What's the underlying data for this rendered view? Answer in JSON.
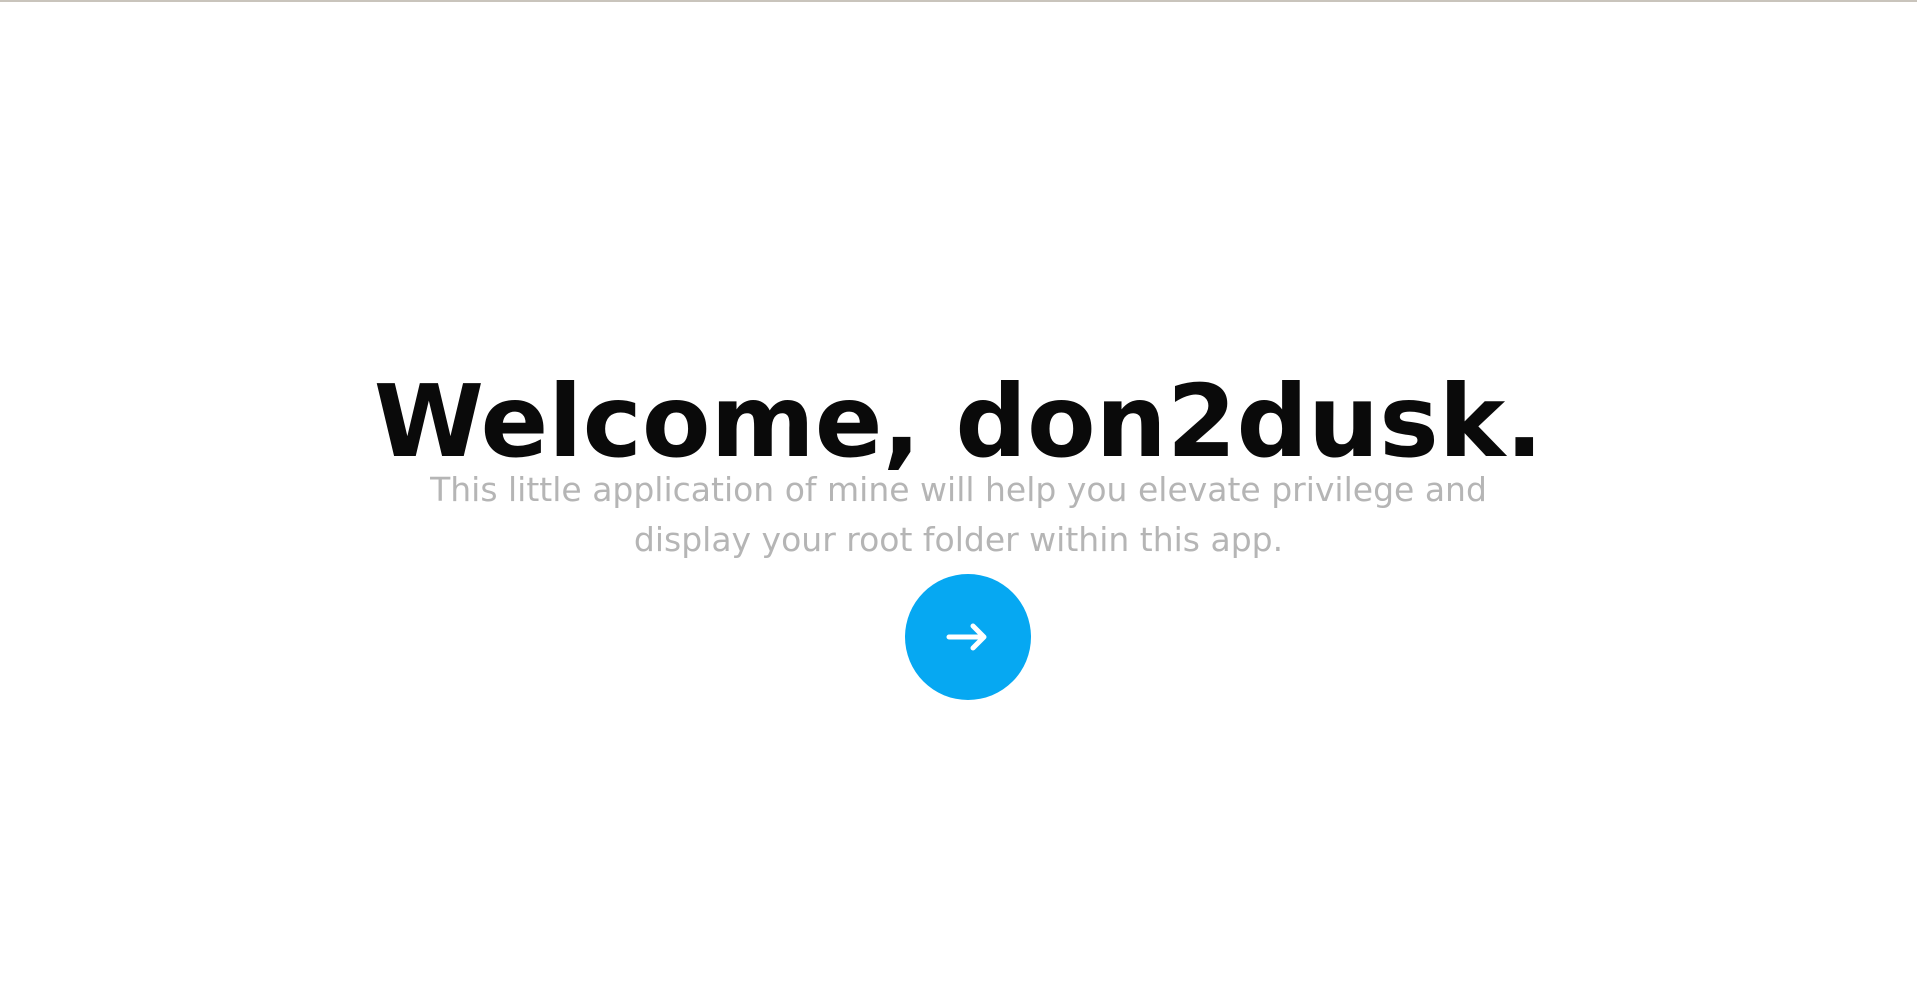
{
  "hero": {
    "title": "Welcome, don2dusk.",
    "subtitle": "This little application of mine will help you elevate privilege and display your root folder within this app.",
    "next_button": {
      "icon": "arrow-right-icon",
      "color": "#06a8f2",
      "icon_color": "#ffffff"
    }
  }
}
